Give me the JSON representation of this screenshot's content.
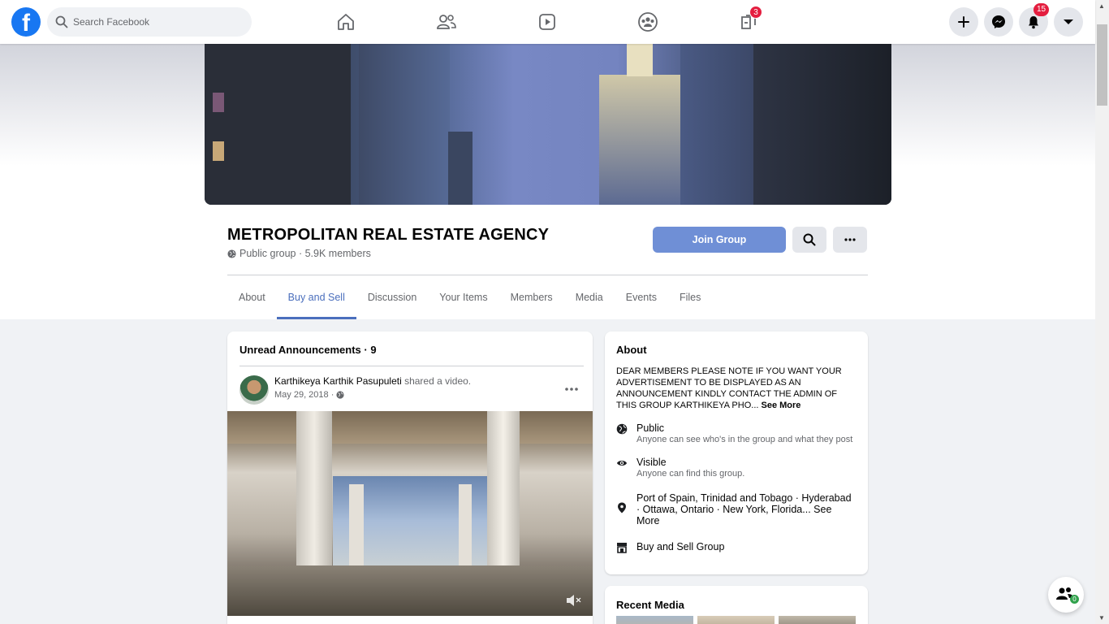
{
  "nav": {
    "search_placeholder": "Search Facebook",
    "groups_badge": "3",
    "notifications_badge": "15",
    "logo_letter": "f"
  },
  "group": {
    "title": "METROPOLITAN REAL ESTATE AGENCY",
    "meta": "Public group · 5.9K members",
    "join_label": "Join Group"
  },
  "tabs": [
    {
      "label": "About"
    },
    {
      "label": "Buy and Sell",
      "active": true
    },
    {
      "label": "Discussion"
    },
    {
      "label": "Your Items"
    },
    {
      "label": "Members"
    },
    {
      "label": "Media"
    },
    {
      "label": "Events"
    },
    {
      "label": "Files"
    }
  ],
  "announcements": {
    "title": "Unread Announcements · 9",
    "post": {
      "author": "Karthikeya Karthik Pasupuleti",
      "action": " shared a video.",
      "date": "May 29, 2018 ·"
    }
  },
  "about": {
    "title": "About",
    "description": "DEAR MEMBERS PLEASE NOTE IF YOU WANT YOUR ADVERTISEMENT TO BE DISPLAYED AS AN ANNOUNCEMENT KINDLY CONTACT THE ADMIN OF THIS GROUP KARTHIKEYA PHO...",
    "see_more": "See More",
    "public_title": "Public",
    "public_sub": "Anyone can see who's in the group and what they post",
    "visible_title": "Visible",
    "visible_sub": "Anyone can find this group.",
    "location": "Port of Spain, Trinidad and Tobago · Hyderabad · Ottawa, Ontario · New York, Florida...",
    "location_see_more": "See More",
    "group_type": "Buy and Sell Group"
  },
  "recent_media": {
    "title": "Recent Media"
  },
  "fab_badge": "0",
  "colors": {
    "brand": "#1877f2",
    "join_button": "#6f8fd6",
    "active_tab": "#4b6fbd",
    "badge": "#e41e3f"
  }
}
